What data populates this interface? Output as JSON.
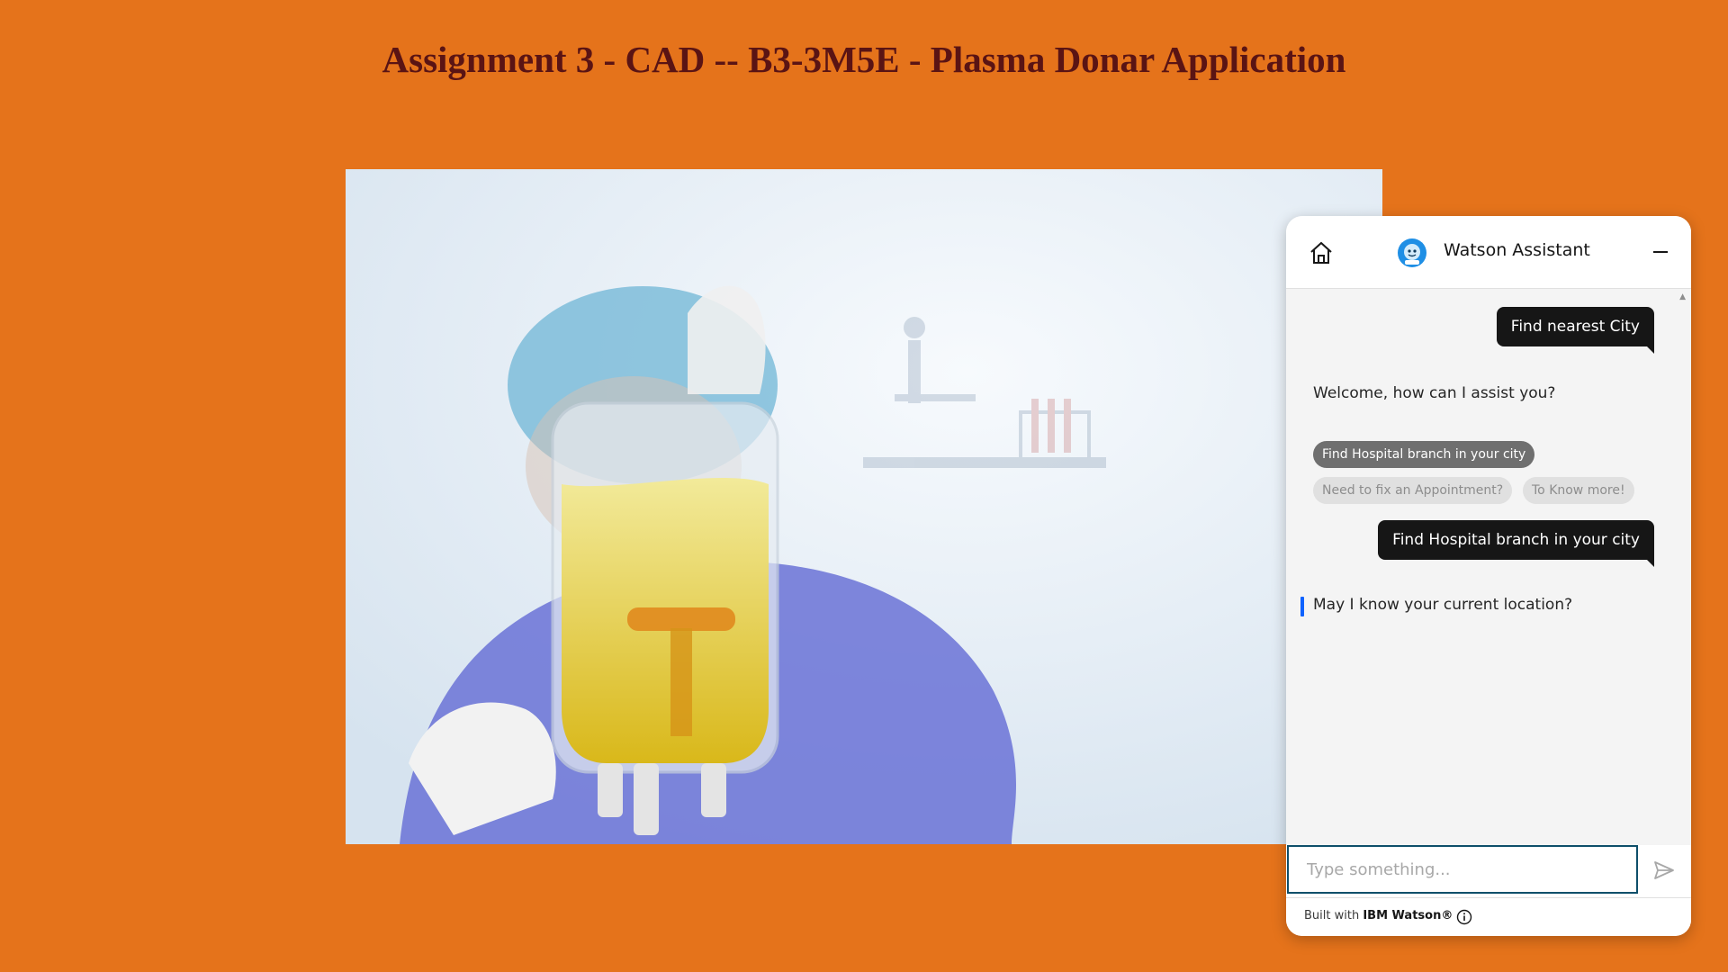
{
  "page": {
    "title": "Assignment 3 - CAD -- B3-3M5E - Plasma Donar Application"
  },
  "hero_image": {
    "icon": "plasma-donation-photo"
  },
  "chat": {
    "header": {
      "title": "Watson Assistant",
      "home_icon": "home-icon",
      "avatar_icon": "watson-avatar-icon",
      "minimize_icon": "minimize-icon"
    },
    "messages": {
      "user_1": "Find nearest City",
      "bot_1": "Welcome, how can I assist you?",
      "options": [
        "Find Hospital branch in your city",
        "Need to fix an Appointment?",
        "To Know more!"
      ],
      "user_2": "Find Hospital branch in your city",
      "bot_2": "May I know your current location?"
    },
    "help_label": "?",
    "input": {
      "placeholder": "Type something..."
    },
    "footer": {
      "prefix": "Built with",
      "brand": "IBM Watson®"
    },
    "colors": {
      "accent": "#0e4f6a",
      "user_bubble": "#161616",
      "background": "#e5731b",
      "title": "#5a1414"
    }
  }
}
